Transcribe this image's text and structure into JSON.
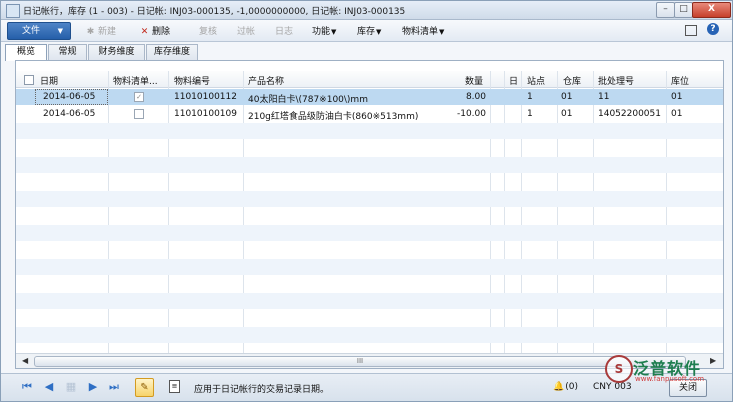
{
  "window": {
    "title": "日记帐行，库存 (1 - 003) - 日记帐: INJ03-000135, -1,0000000000, 日记帐: INJ03-000135",
    "buttons": {
      "minimize": "–",
      "maximize": "□",
      "close": "X"
    }
  },
  "toolbar": {
    "file_label": "文件",
    "new_label": "新建",
    "delete_label": "删除",
    "copy_label": "复核",
    "post_label": "过帐",
    "log_label": "日志",
    "functions_label": "功能",
    "inventory_label": "库存",
    "bom_label": "物料清单"
  },
  "tabs": [
    "概览",
    "常规",
    "财务维度",
    "库存维度"
  ],
  "grid": {
    "columns": [
      "日期",
      "物料清单...",
      "物料编号",
      "产品名称",
      "数量",
      "日",
      "站点",
      "仓库",
      "批处理号",
      "库位"
    ],
    "rows": [
      {
        "date": "2014-06-05",
        "bom": true,
        "item": "11010100112",
        "name": "40太阳白卡\\(787※100\\)mm",
        "qty": "8.00",
        "site": "1",
        "warehouse": "01",
        "batch": "11",
        "location": "01"
      },
      {
        "date": "2014-06-05",
        "bom": false,
        "item": "11010100109",
        "name": "210g红塔食品级防油白卡(860※513mm)",
        "qty": "-10.00",
        "site": "1",
        "warehouse": "01",
        "batch": "14052200051",
        "location": "01"
      }
    ],
    "scroll_grip": "III"
  },
  "status": {
    "message": "应用于日记帐行的交易记录日期。",
    "notifications": "(0)",
    "currency": "CNY",
    "company": "003",
    "close_label": "关闭"
  },
  "watermark": {
    "text": "泛普软件",
    "url": "www.fanpusoft.com"
  }
}
